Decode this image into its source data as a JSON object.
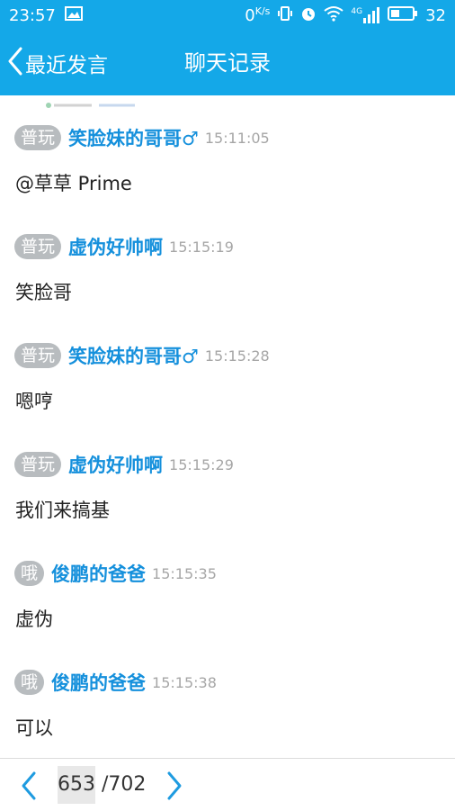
{
  "status_bar": {
    "time": "23:57",
    "net_speed": "0",
    "net_speed_unit": "K/s",
    "network_type": "4G",
    "battery": "32"
  },
  "title_bar": {
    "back_label": "最近发言",
    "title": "聊天记录"
  },
  "messages": [
    {
      "badge": "普玩",
      "sender": "笑脸妹的哥哥♂",
      "time": "15:11:05",
      "text": "@草草 Prime"
    },
    {
      "badge": "普玩",
      "sender": "虚伪好帅啊",
      "time": "15:15:19",
      "text": "笑脸哥"
    },
    {
      "badge": "普玩",
      "sender": "笑脸妹的哥哥♂",
      "time": "15:15:28",
      "text": "嗯哼"
    },
    {
      "badge": "普玩",
      "sender": "虚伪好帅啊",
      "time": "15:15:29",
      "text": "我们来搞基"
    },
    {
      "badge": "哦",
      "sender": "俊鹏的爸爸",
      "time": "15:15:35",
      "text": "虚伪"
    },
    {
      "badge": "哦",
      "sender": "俊鹏的爸爸",
      "time": "15:15:38",
      "text": "可以"
    }
  ],
  "pager": {
    "current_page": "653",
    "total": "/702"
  },
  "colors": {
    "primary": "#14a8e8",
    "sender": "#1590dc",
    "badge_bg": "#b8bcbf",
    "time": "#a6a6a6"
  },
  "icons": {
    "status": [
      "image-icon",
      "vibrate-icon",
      "alarm-icon",
      "wifi-icon",
      "signal-icon",
      "battery-icon"
    ],
    "nav": [
      "back-chevron-icon",
      "prev-page-icon",
      "next-page-icon"
    ]
  }
}
